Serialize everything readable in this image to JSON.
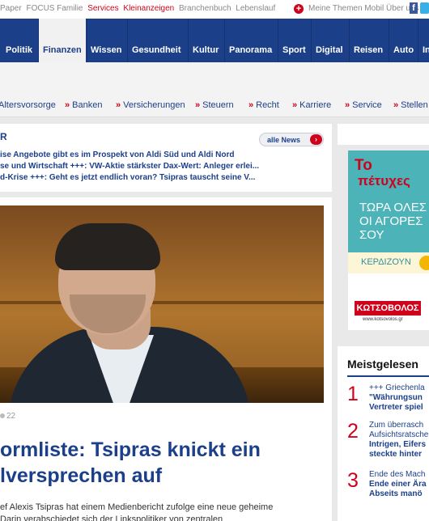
{
  "topbar": {
    "links": [
      "Paper",
      "FOCUS Familie",
      "Services",
      "Kleinanzeigen",
      "Branchenbuch",
      "Lebenslauf"
    ],
    "red_links": [
      "Services",
      "Kleinanzeigen"
    ],
    "right_text": "Meine Themen Mobil Über uns",
    "facebook_letter": "f"
  },
  "nav": {
    "items": [
      "Politik",
      "Finanzen",
      "Wissen",
      "Gesundheit",
      "Kultur",
      "Panorama",
      "Sport",
      "Digital",
      "Reisen",
      "Auto",
      "In"
    ],
    "active": "Finanzen"
  },
  "subnav": {
    "items": [
      "Altersvorsorge",
      "Banken",
      "Versicherungen",
      "Steuern",
      "Recht",
      "Karriere",
      "Service",
      "Stellen"
    ]
  },
  "ticker": {
    "label": "R",
    "lines": [
      "ise Angebote gibt es im Prospekt von Aldi Süd und Aldi Nord",
      "se und Wirtschaft +++: VW-Aktie stärkster Dax-Wert: Anleger erlei...",
      "d-Krise +++: Geht es jetzt endlich voran? Tsipras tauscht seine V..."
    ],
    "all_news": "alle News",
    "all_news_arrow": "›"
  },
  "article": {
    "photo_count": "22",
    "headline_line1": "ormliste: Tsipras knickt ein",
    "headline_line2": "lversprechen auf",
    "teaser_line1": "ef Alexis Tsipras hat einem Medienbericht zufolge eine neue geheime",
    "teaser_line2": "Darin verabschiedet sich der Linkspolitiker von zentralen"
  },
  "ad": {
    "line1": "Το",
    "line2": "πέτυχες",
    "line3": "ΤΩΡΑ ΟΛΕΣ",
    "line4": "ΟΙ ΑΓΟΡΕΣ",
    "line5": "ΣΟΥ",
    "gain": "ΚΕΡΔΙΖΟΥΝ",
    "brand": "ΚΩΤΣΟΒΟΛΟΣ",
    "site": "www.kotsovolos.gr"
  },
  "most_read": {
    "title": "Meistgelesen",
    "items": [
      {
        "num": "1",
        "l1": "+++ Griechenla",
        "l2": "\"Währungsun",
        "l3": "Vertreter spiel"
      },
      {
        "num": "2",
        "l1": "Zum überrasch",
        "l1b": "Aufsichtsratsche",
        "l2": "Intrigen, Eifers",
        "l3": "steckte hinter"
      },
      {
        "num": "3",
        "l1": "Ende des Mach",
        "l2": "Ende einer Ära",
        "l3": "Abseits manö"
      }
    ]
  },
  "colors": {
    "nav_blue": "#1c3f8a",
    "accent_red": "#d0021b",
    "ad_teal": "#4cb3b8"
  }
}
